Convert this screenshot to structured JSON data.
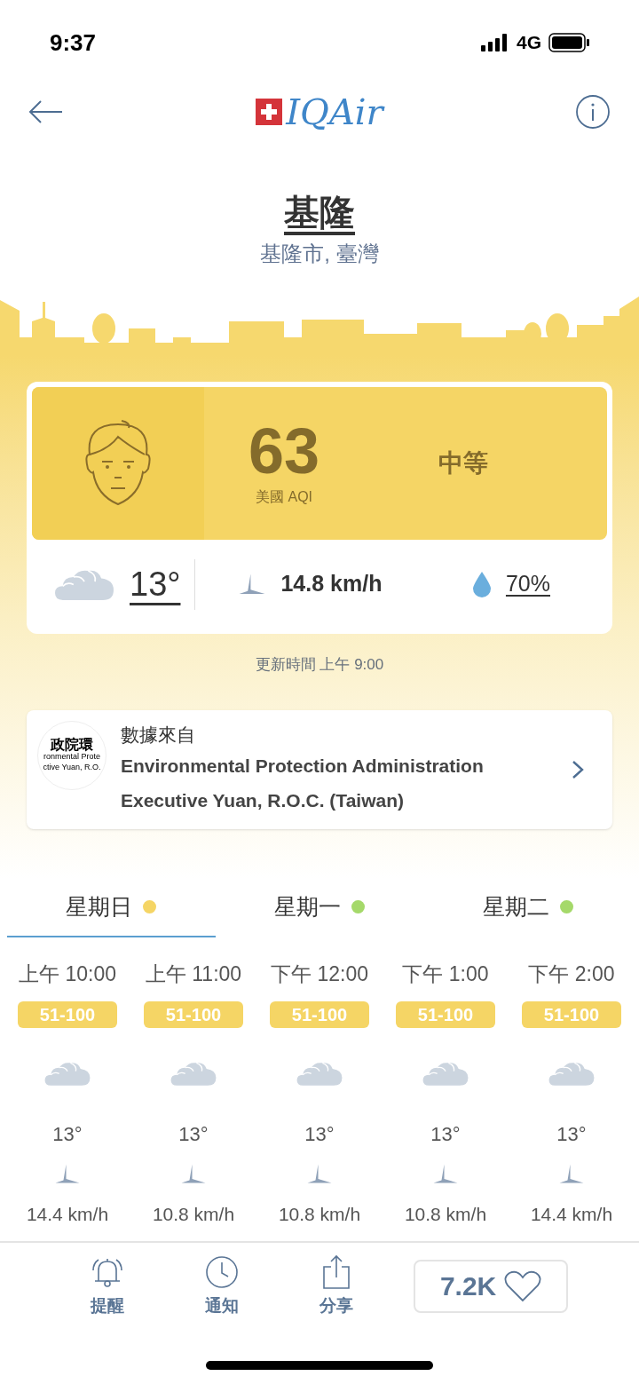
{
  "status_bar": {
    "time": "9:37",
    "network": "4G"
  },
  "header": {
    "logo_text": "IQAir"
  },
  "city": {
    "name": "基隆",
    "region": "基隆市, 臺灣"
  },
  "aqi_card": {
    "value": "63",
    "unit": "美國 AQI",
    "level_label": "中等",
    "color": "#f5d565",
    "temperature": "13°",
    "wind": "14.8 km/h",
    "humidity": "70%"
  },
  "updated": "更新時間 上午 9:00",
  "source": {
    "label": "數據來自",
    "name": "Environmental Protection Administration Executive Yuan, R.O.C. (Taiwan)",
    "logo_lines": [
      "政院環",
      "ronmental Prote",
      "ctive Yuan, R.O."
    ]
  },
  "day_tabs": [
    {
      "label": "星期日",
      "selected": true,
      "color": "#f5d565"
    },
    {
      "label": "星期一",
      "selected": false,
      "color": "#a5d96a"
    },
    {
      "label": "星期二",
      "selected": false,
      "color": "#a5d96a"
    }
  ],
  "hours": [
    {
      "time": "上午 10:00",
      "range": "51-100",
      "color": "#f5d565",
      "temperature": "13°",
      "wind": "14.4 km/h"
    },
    {
      "time": "上午 11:00",
      "range": "51-100",
      "color": "#f5d565",
      "temperature": "13°",
      "wind": "10.8 km/h"
    },
    {
      "time": "下午 12:00",
      "range": "51-100",
      "color": "#f5d565",
      "temperature": "13°",
      "wind": "10.8 km/h"
    },
    {
      "time": "下午 1:00",
      "range": "51-100",
      "color": "#f5d565",
      "temperature": "13°",
      "wind": "10.8 km/h"
    },
    {
      "time": "下午 2:00",
      "range": "51-100",
      "color": "#f5d565",
      "temperature": "13°",
      "wind": "14.4 km/h"
    }
  ],
  "bottom_bar": {
    "items": [
      {
        "kind": "bell",
        "label": "提醒"
      },
      {
        "kind": "clock",
        "label": "通知"
      },
      {
        "kind": "share",
        "label": "分享"
      }
    ],
    "likes": "7.2K"
  }
}
